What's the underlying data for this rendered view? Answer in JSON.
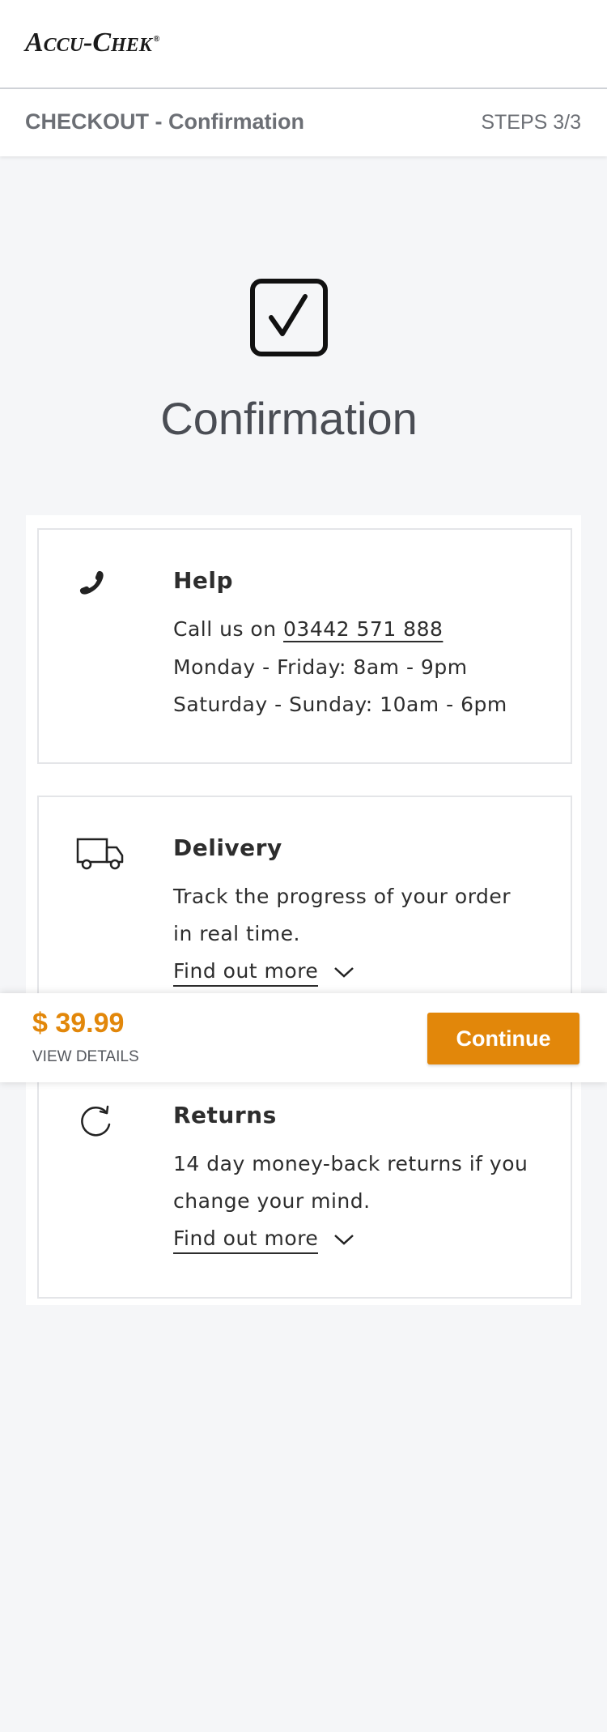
{
  "header": {
    "logo_text": "Accu-Chek",
    "logo_mark": "®"
  },
  "checkout": {
    "title": "CHECKOUT - Confirmation",
    "steps": "STEPS 3/3"
  },
  "hero": {
    "icon": "checkbox-checked-icon",
    "title": "Confirmation"
  },
  "help": {
    "icon": "phone-icon",
    "heading": "Help",
    "call_prefix": "Call us on ",
    "phone": "03442 571 888",
    "hours_weekday": "Monday - Friday: 8am - 9pm",
    "hours_weekend": "Saturday - Sunday: 10am - 6pm"
  },
  "delivery": {
    "icon": "truck-icon",
    "heading": "Delivery",
    "line1": "Track the progress of your order",
    "line2": "in real time.",
    "link": "Find out more"
  },
  "returns": {
    "icon": "refresh-icon",
    "heading": "Returns",
    "line1": "14 day money-back returns if you",
    "line2": "change your mind.",
    "link": "Find out more"
  },
  "summary": {
    "price": "$ 39.99",
    "view_details": "VIEW DETAILS",
    "continue_label": "Continue"
  },
  "colors": {
    "accent": "#e2870a",
    "background": "#f5f6f8",
    "text_muted": "#6c6f75"
  }
}
